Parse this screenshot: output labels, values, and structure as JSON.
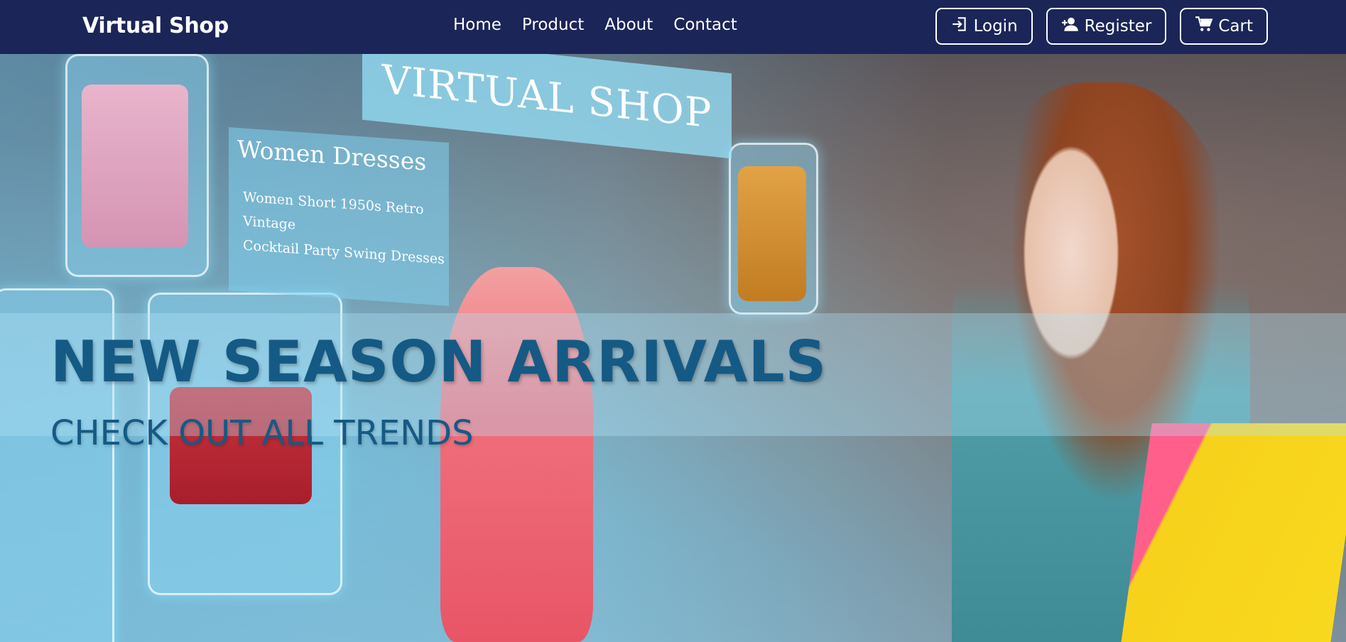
{
  "brand": "Virtual Shop",
  "nav": {
    "links": [
      "Home",
      "Product",
      "About",
      "Contact"
    ],
    "actions": [
      {
        "label": "Login",
        "icon": "login-icon"
      },
      {
        "label": "Register",
        "icon": "user-plus-icon"
      },
      {
        "label": "Cart",
        "icon": "cart-icon"
      }
    ]
  },
  "hero": {
    "sign_text": "VIRTUAL SHOP",
    "panel_title": "Women  Dresses",
    "panel_desc_1": "Women Short 1950s Retro Vintage",
    "panel_desc_2": "Cocktail Party Swing Dresses",
    "title": "NEW SEASON ARRIVALS",
    "subtitle": "CHECK OUT ALL TRENDS"
  },
  "colors": {
    "navbar": "#1b2557",
    "hero_text": "#155a84",
    "accent_yellow": "#f8d91e",
    "accent_pink": "#ff5f8a"
  }
}
